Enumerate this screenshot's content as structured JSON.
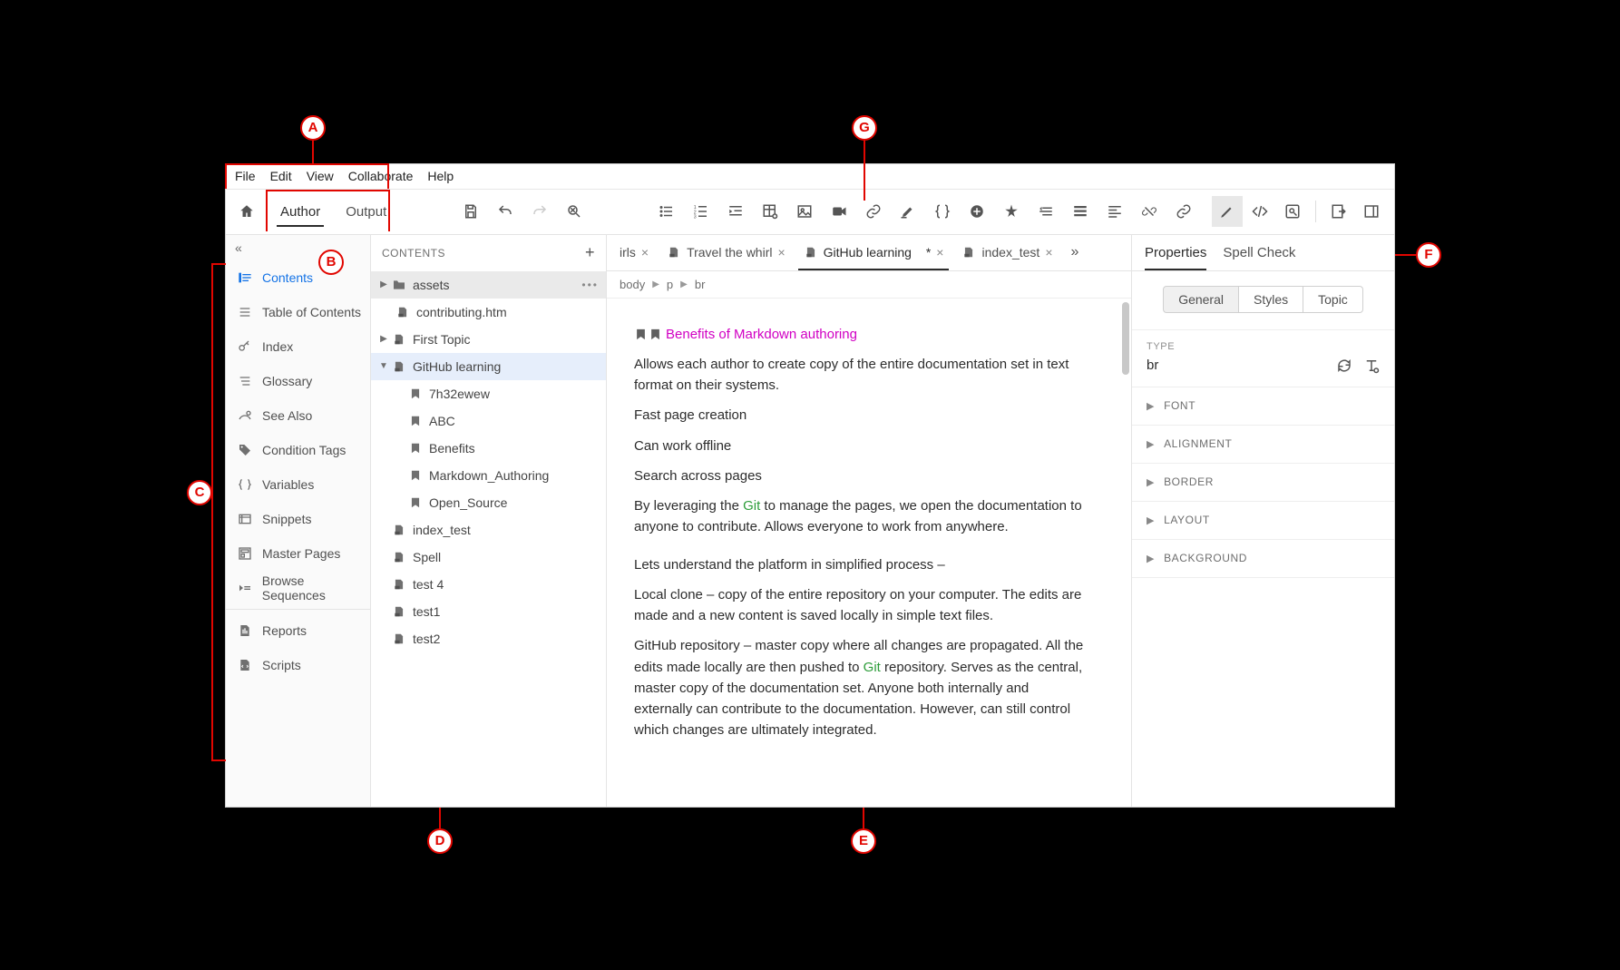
{
  "menubar": [
    "File",
    "Edit",
    "View",
    "Collaborate",
    "Help"
  ],
  "modes": {
    "author": "Author",
    "output": "Output"
  },
  "nav": {
    "contents": "Contents",
    "toc": "Table of Contents",
    "index": "Index",
    "glossary": "Glossary",
    "seealso": "See Also",
    "condition": "Condition Tags",
    "variables": "Variables",
    "snippets": "Snippets",
    "master": "Master Pages",
    "browse": "Browse Sequences",
    "reports": "Reports",
    "scripts": "Scripts"
  },
  "tree": {
    "header": "CONTENTS",
    "items": {
      "assets": "assets",
      "contributing": "contributing.htm",
      "first_topic": "First Topic",
      "github": "GitHub learning",
      "seven": "7h32ewew",
      "abc": "ABC",
      "benefits": "Benefits",
      "markdown": "Markdown_Authoring",
      "opensource": "Open_Source",
      "index_test": "index_test",
      "spell": "Spell",
      "test4": "test 4",
      "test1": "test1",
      "test2": "test2"
    }
  },
  "tabs": {
    "irls": "irls",
    "travel": "Travel the whirl",
    "github": "GitHub learning",
    "github_dirty": "*",
    "index_test": "index_test"
  },
  "breadcrumb": [
    "body",
    "p",
    "br"
  ],
  "doc": {
    "title": "Benefits of Markdown authoring",
    "p1": "Allows each author to create copy of the entire documentation set in text format on their systems.",
    "p2": "Fast page creation",
    "p3": "Can work offline",
    "p4": "Search across pages",
    "p5a": "By leveraging the ",
    "p5git": "Git",
    "p5b": " to manage the pages, we open the documentation to anyone to contribute. Allows everyone to work from anywhere.",
    "p6": "Lets understand the platform in simplified process –",
    "p7": "Local clone – copy of the entire repository on your computer. The edits are made and a new content is saved locally in simple text files.",
    "p8a": "GitHub repository – master copy where all changes are propagated. All the edits made locally are then pushed to ",
    "p8git": "Git",
    "p8b": " repository. Serves as the central, master copy of the documentation set. Anyone both internally and externally can contribute to the documentation. However, can still control which changes are ultimately integrated."
  },
  "props": {
    "tab_properties": "Properties",
    "tab_spell": "Spell Check",
    "seg_general": "General",
    "seg_styles": "Styles",
    "seg_topic": "Topic",
    "type_label": "TYPE",
    "type_value": "br",
    "acc": [
      "FONT",
      "ALIGNMENT",
      "BORDER",
      "LAYOUT",
      "BACKGROUND"
    ]
  },
  "annotations": {
    "A": "A",
    "B": "B",
    "C": "C",
    "D": "D",
    "E": "E",
    "F": "F",
    "G": "G"
  }
}
